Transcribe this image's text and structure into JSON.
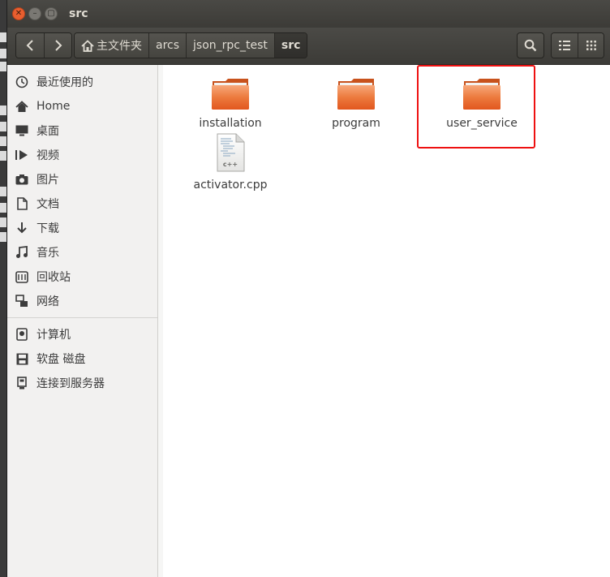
{
  "window": {
    "title": "src"
  },
  "breadcrumbs": [
    {
      "label": "主文件夹",
      "icon": "home-icon"
    },
    {
      "label": "arcs"
    },
    {
      "label": "json_rpc_test"
    },
    {
      "label": "src",
      "active": true
    }
  ],
  "sidebar": {
    "places": [
      {
        "label": "最近使用的",
        "icon": "recent-icon"
      },
      {
        "label": "Home",
        "icon": "home-icon"
      },
      {
        "label": "桌面",
        "icon": "desktop-icon"
      },
      {
        "label": "视频",
        "icon": "video-icon"
      },
      {
        "label": "图片",
        "icon": "camera-icon"
      },
      {
        "label": "文档",
        "icon": "document-icon"
      },
      {
        "label": "下载",
        "icon": "download-icon"
      },
      {
        "label": "音乐",
        "icon": "music-icon"
      },
      {
        "label": "回收站",
        "icon": "trash-icon"
      },
      {
        "label": "网络",
        "icon": "network-icon"
      }
    ],
    "devices": [
      {
        "label": "计算机",
        "icon": "computer-icon"
      },
      {
        "label": "软盘 磁盘",
        "icon": "floppy-icon"
      },
      {
        "label": "连接到服务器",
        "icon": "server-icon"
      }
    ]
  },
  "files": [
    {
      "name": "installation",
      "type": "folder"
    },
    {
      "name": "program",
      "type": "folder"
    },
    {
      "name": "user_service",
      "type": "folder",
      "highlighted": true
    },
    {
      "name": "activator.cpp",
      "type": "cpp-file",
      "icon_text": "c++"
    }
  ],
  "colors": {
    "folder": "#e2571e",
    "folder_light": "#f7a77a",
    "highlight": "#e11111"
  }
}
